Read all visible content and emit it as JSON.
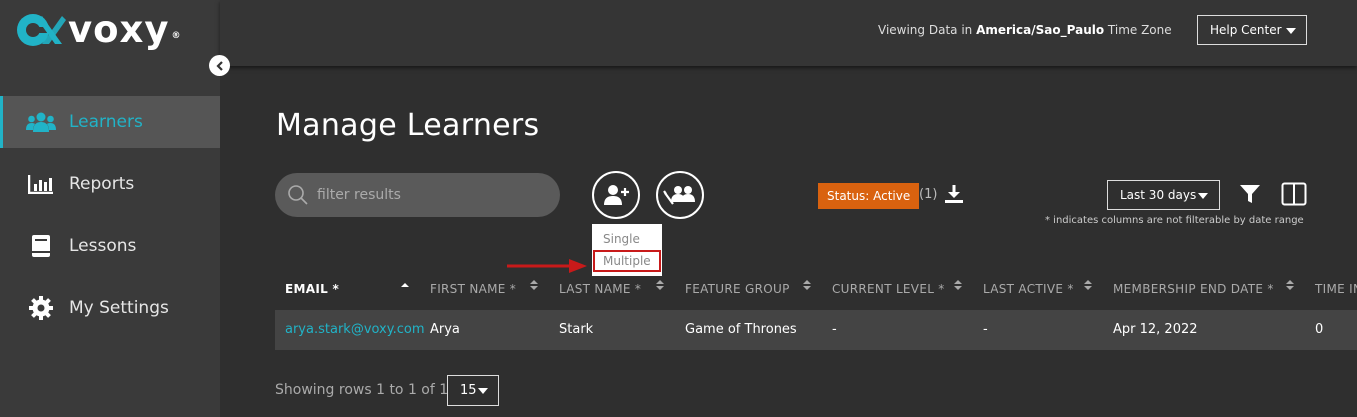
{
  "brand": {
    "name": "voxy",
    "reg": "®",
    "accent": "#21b3c7",
    "orange": "#d9620f",
    "highlight_red": "#c81a1a"
  },
  "sidebar": {
    "items": [
      {
        "label": "Learners",
        "icon": "users-icon",
        "active": true
      },
      {
        "label": "Reports",
        "icon": "bar-chart-icon",
        "active": false
      },
      {
        "label": "Lessons",
        "icon": "book-icon",
        "active": false
      },
      {
        "label": "My Settings",
        "icon": "gear-icon",
        "active": false
      }
    ]
  },
  "header": {
    "tz_prefix": "Viewing Data in ",
    "tz_zone": "America/Sao_Paulo",
    "tz_suffix": " Time Zone",
    "help_label": "Help Center"
  },
  "main": {
    "title": "Manage Learners",
    "search_placeholder": "filter results",
    "add_menu": {
      "items": [
        "Single",
        "Multiple"
      ],
      "highlighted": "Multiple"
    },
    "status_badge": "Status: Active",
    "filter_count": "(1)",
    "date_range": "Last 30 days",
    "note": "* indicates columns are not filterable by date range"
  },
  "table": {
    "columns": [
      "EMAIL *",
      "FIRST NAME *",
      "LAST NAME *",
      "FEATURE GROUP",
      "CURRENT LEVEL *",
      "LAST ACTIVE *",
      "MEMBERSHIP END DATE *",
      "TIME IN"
    ],
    "rows": [
      {
        "email": "arya.stark@voxy.com",
        "first": "Arya",
        "last": "Stark",
        "group": "Game of Thrones",
        "level": "-",
        "active": "-",
        "end": "Apr 12, 2022",
        "time": "0"
      }
    ]
  },
  "pager": {
    "text": "Showing rows 1 to 1 of 1",
    "per_page": "15"
  }
}
